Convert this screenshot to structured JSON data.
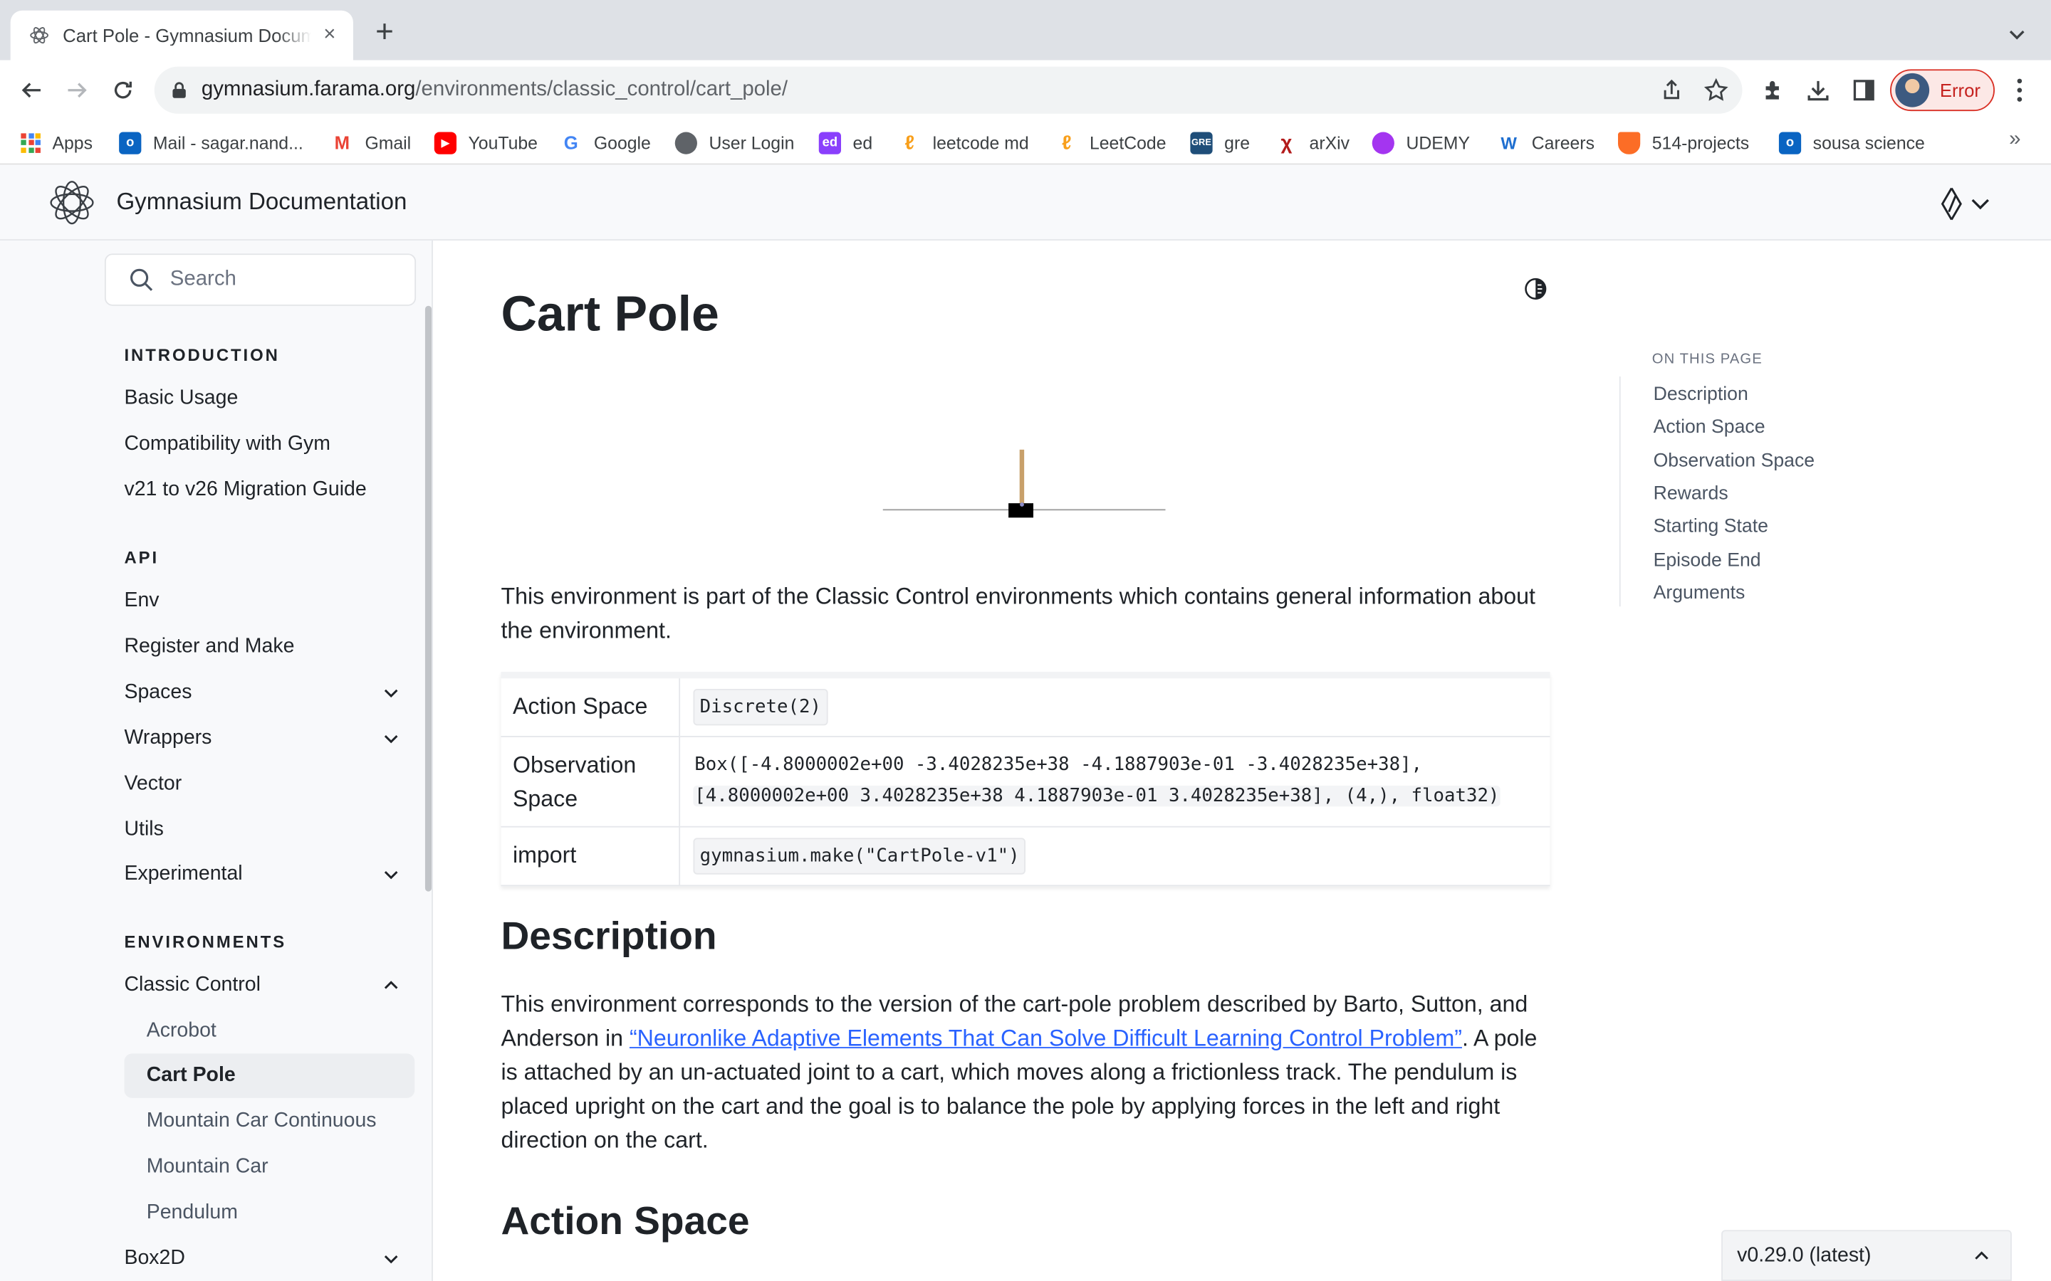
{
  "browser": {
    "tab_title": "Cart Pole - Gymnasium Documentation",
    "url_host": "gymnasium.farama.org",
    "url_path": "/environments/classic_control/cart_pole/",
    "profile_label": "Error",
    "bookmarks": [
      {
        "label": "Apps",
        "icon": "apps-grid-icon"
      },
      {
        "label": "Mail - sagar.nand...",
        "icon": "outlook-icon"
      },
      {
        "label": "Gmail",
        "icon": "gmail-icon"
      },
      {
        "label": "YouTube",
        "icon": "youtube-icon"
      },
      {
        "label": "Google",
        "icon": "google-icon"
      },
      {
        "label": "User Login",
        "icon": "globe-icon"
      },
      {
        "label": "ed",
        "icon": "ed-icon"
      },
      {
        "label": "leetcode md",
        "icon": "leetcode-icon"
      },
      {
        "label": "LeetCode",
        "icon": "leetcode-icon"
      },
      {
        "label": "gre",
        "icon": "gre-icon"
      },
      {
        "label": "arXiv",
        "icon": "arxiv-icon"
      },
      {
        "label": "UDEMY",
        "icon": "udemy-icon"
      },
      {
        "label": "Careers",
        "icon": "careers-icon"
      },
      {
        "label": "514-projects",
        "icon": "gitlab-icon"
      },
      {
        "label": "sousa science",
        "icon": "outlook-icon"
      }
    ],
    "bookmarks_more": "»"
  },
  "site": {
    "title": "Gymnasium Documentation"
  },
  "sidebar": {
    "search_placeholder": "Search",
    "sections": [
      {
        "caption": "INTRODUCTION",
        "items": [
          {
            "label": "Basic Usage"
          },
          {
            "label": "Compatibility with Gym"
          },
          {
            "label": "v21 to v26 Migration Guide"
          }
        ]
      },
      {
        "caption": "API",
        "items": [
          {
            "label": "Env"
          },
          {
            "label": "Register and Make"
          },
          {
            "label": "Spaces",
            "expandable": true
          },
          {
            "label": "Wrappers",
            "expandable": true
          },
          {
            "label": "Vector"
          },
          {
            "label": "Utils"
          },
          {
            "label": "Experimental",
            "expandable": true
          }
        ]
      },
      {
        "caption": "ENVIRONMENTS",
        "items": [
          {
            "label": "Classic Control",
            "expanded": true
          },
          {
            "label": "Acrobot",
            "sub": true
          },
          {
            "label": "Cart Pole",
            "sub": true,
            "active": true
          },
          {
            "label": "Mountain Car Continuous",
            "sub": true
          },
          {
            "label": "Mountain Car",
            "sub": true
          },
          {
            "label": "Pendulum",
            "sub": true
          },
          {
            "label": "Box2D",
            "expandable": true
          }
        ]
      }
    ]
  },
  "content": {
    "title": "Cart Pole",
    "intro": "This environment is part of the Classic Control environments which contains general information about the environment.",
    "table": [
      {
        "key": "Action Space",
        "value": "Discrete(2)"
      },
      {
        "key": "Observation Space",
        "value_line1": "Box([-4.8000002e+00 -3.4028235e+38 -4.1887903e-01 -3.4028235e+38],",
        "value_line2": "[4.8000002e+00 3.4028235e+38 4.1887903e-01 3.4028235e+38], (4,), float32)"
      },
      {
        "key": "import",
        "value": "gymnasium.make(\"CartPole-v1\")"
      }
    ],
    "description_heading": "Description",
    "description_pre": "This environment corresponds to the version of the cart-pole problem described by Barto, Sutton, and Anderson in ",
    "description_link": "“Neuronlike Adaptive Elements That Can Solve Difficult Learning Control Problem”",
    "description_post": ". A pole is attached by an un-actuated joint to a cart, which moves along a frictionless track. The pendulum is placed upright on the cart and the goal is to balance the pole by applying forces in the left and right direction on the cart.",
    "action_space_heading": "Action Space"
  },
  "toc": {
    "caption": "ON THIS PAGE",
    "items": [
      "Description",
      "Action Space",
      "Observation Space",
      "Rewards",
      "Starting State",
      "Episode End",
      "Arguments"
    ]
  },
  "version_badge": "v0.29.0 (latest)",
  "colors": {
    "link": "#2962ff",
    "pole": "#c8a06a",
    "profile_error": "#d93025"
  }
}
